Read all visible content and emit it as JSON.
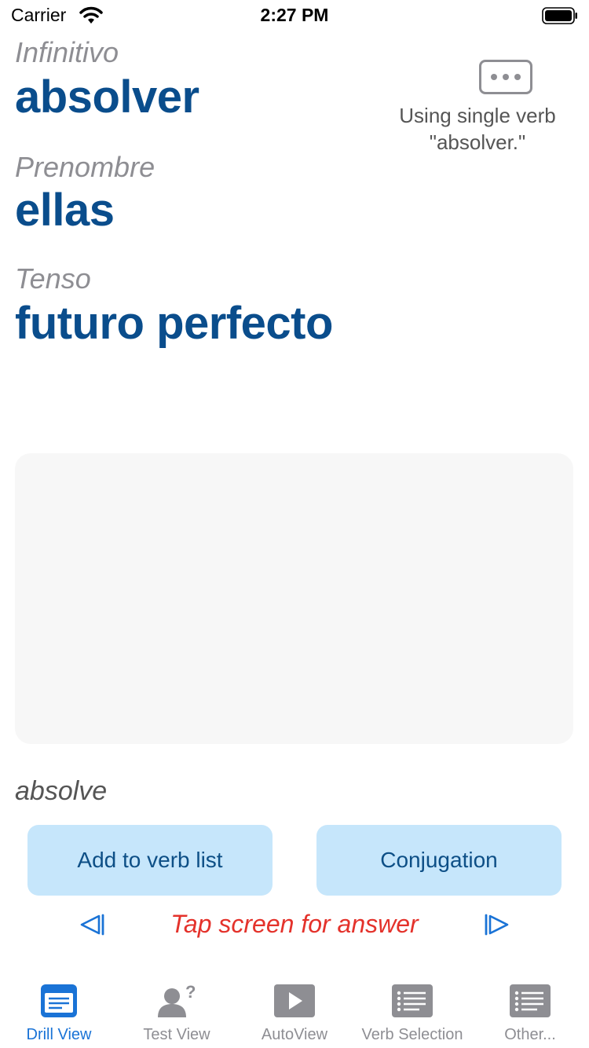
{
  "status_bar": {
    "carrier": "Carrier",
    "time": "2:27 PM"
  },
  "drill": {
    "infinitive_caption": "Infinitivo",
    "infinitive_value": "absolver",
    "pronoun_caption": "Prenombre",
    "pronoun_value": "ellas",
    "tense_caption": "Tenso",
    "tense_value": "futuro perfecto",
    "note_line1": "Using single verb",
    "note_line2": "\"absolver.\"",
    "hint": "absolve"
  },
  "actions": {
    "add_label": "Add to verb list",
    "conjugation_label": "Conjugation",
    "tap_text": "Tap screen for answer"
  },
  "tabs": [
    {
      "label": "Drill View",
      "icon": "drill-view-icon",
      "active": true
    },
    {
      "label": "Test View",
      "icon": "test-view-icon"
    },
    {
      "label": "AutoView",
      "icon": "play-icon"
    },
    {
      "label": "Verb Selection",
      "icon": "list-icon"
    },
    {
      "label": "Other...",
      "icon": "list-icon"
    }
  ],
  "colors": {
    "accent": "#1a73d6",
    "value_text": "#0a4d8c",
    "button_bg": "#c6e6fb",
    "alert": "#e4322b"
  }
}
